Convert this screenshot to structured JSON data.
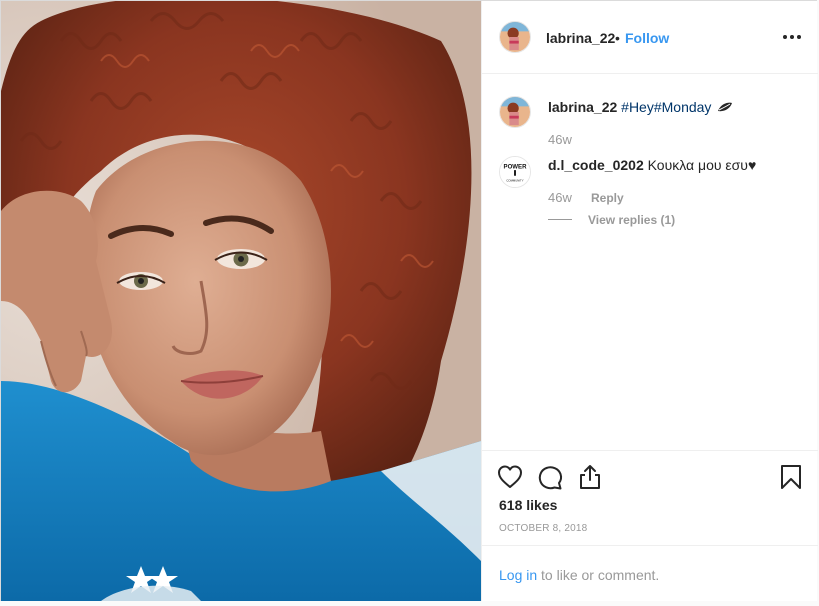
{
  "post": {
    "username": "labrina_22",
    "separator": "•",
    "follow_label": "Follow",
    "more_icon": "more-options-icon"
  },
  "caption": {
    "username": "labrina_22",
    "hashtag1": "#Hey",
    "hashtag2": "#Monday",
    "emoji_icon": "leaf-icon",
    "time": "46w"
  },
  "comments": [
    {
      "username": "d.l_code_0202",
      "text": "Κουκλα μου εσυ♥",
      "time": "46w",
      "reply_label": "Reply",
      "view_replies": "View replies (1)",
      "avatar_text_top": "POWER",
      "avatar_text_bottom": "COMMUNITY"
    }
  ],
  "actions": {
    "like_icon": "heart-icon",
    "comment_icon": "comment-icon",
    "share_icon": "share-icon",
    "save_icon": "bookmark-icon",
    "likes": "618 likes",
    "date": "OCTOBER 8, 2018"
  },
  "login": {
    "link": "Log in",
    "rest": " to like or comment."
  },
  "colors": {
    "link_blue": "#3897f0",
    "hashtag_blue": "#003569",
    "muted": "#999999",
    "border": "#efefef"
  }
}
